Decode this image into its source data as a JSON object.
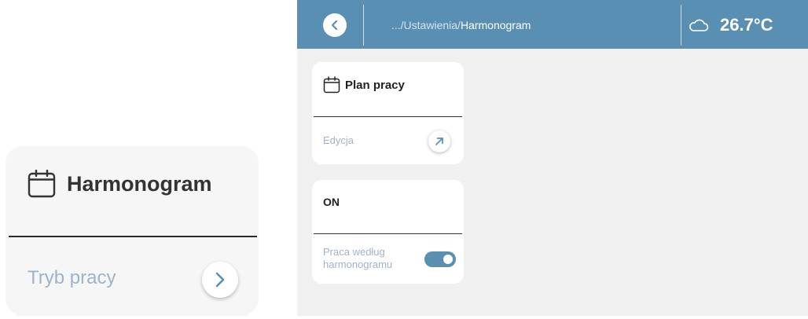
{
  "zoom_card": {
    "title": "Harmonogram",
    "icon": "calendar-icon",
    "subtitle": "Tryb pracy",
    "arrow_icon": "chevron-right-icon"
  },
  "topbar": {
    "back_icon": "chevron-left-icon",
    "breadcrumb_path": ".../Ustawienia/",
    "breadcrumb_current": "Harmonogram",
    "weather_icon": "cloud-icon",
    "temperature": "26.7°C"
  },
  "cards": {
    "schedule": {
      "title": "Plan pracy",
      "icon": "calendar-icon",
      "action_label": "Edycja",
      "action_icon": "arrow-up-right-icon"
    },
    "status": {
      "title": "ON",
      "toggle_label": "Praca według harmonogramu",
      "toggle_on": true
    }
  },
  "colors": {
    "accent": "#5a8fb4",
    "muted_text": "#9fb3c8",
    "panel_bg": "#f0f0f0",
    "card_bg": "#ffffff"
  }
}
